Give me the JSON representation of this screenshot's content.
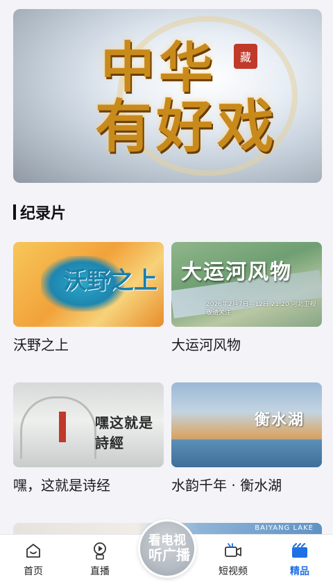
{
  "hero": {
    "title_line1": "中华",
    "title_line2": "有好戏",
    "seal": "藏"
  },
  "section": {
    "title": "纪录片"
  },
  "cards": [
    {
      "title": "沃野之上",
      "art_text": "沃野之上"
    },
    {
      "title": "大运河风物",
      "art_text": "大运河风物",
      "art_sub": "2026年2月7日—12日 21:20 河北卫视 敬请关注"
    },
    {
      "title": "嘿，这就是诗经",
      "art_text": "嘿这就是詩經"
    },
    {
      "title": "水韵千年 · 衡水湖",
      "art_text": "衡水湖"
    }
  ],
  "peek_text": "BAIYANG LAKE",
  "tabbar": {
    "items": [
      {
        "label": "首页",
        "icon": "home-icon"
      },
      {
        "label": "直播",
        "icon": "live-icon"
      },
      {
        "label": "短视频",
        "icon": "short-video-icon"
      },
      {
        "label": "精品",
        "icon": "premium-icon",
        "active": true
      }
    ],
    "center_line1": "看电视",
    "center_line2": "听广播"
  },
  "colors": {
    "accent": "#1f6fe5",
    "background": "#f3f3f8"
  }
}
